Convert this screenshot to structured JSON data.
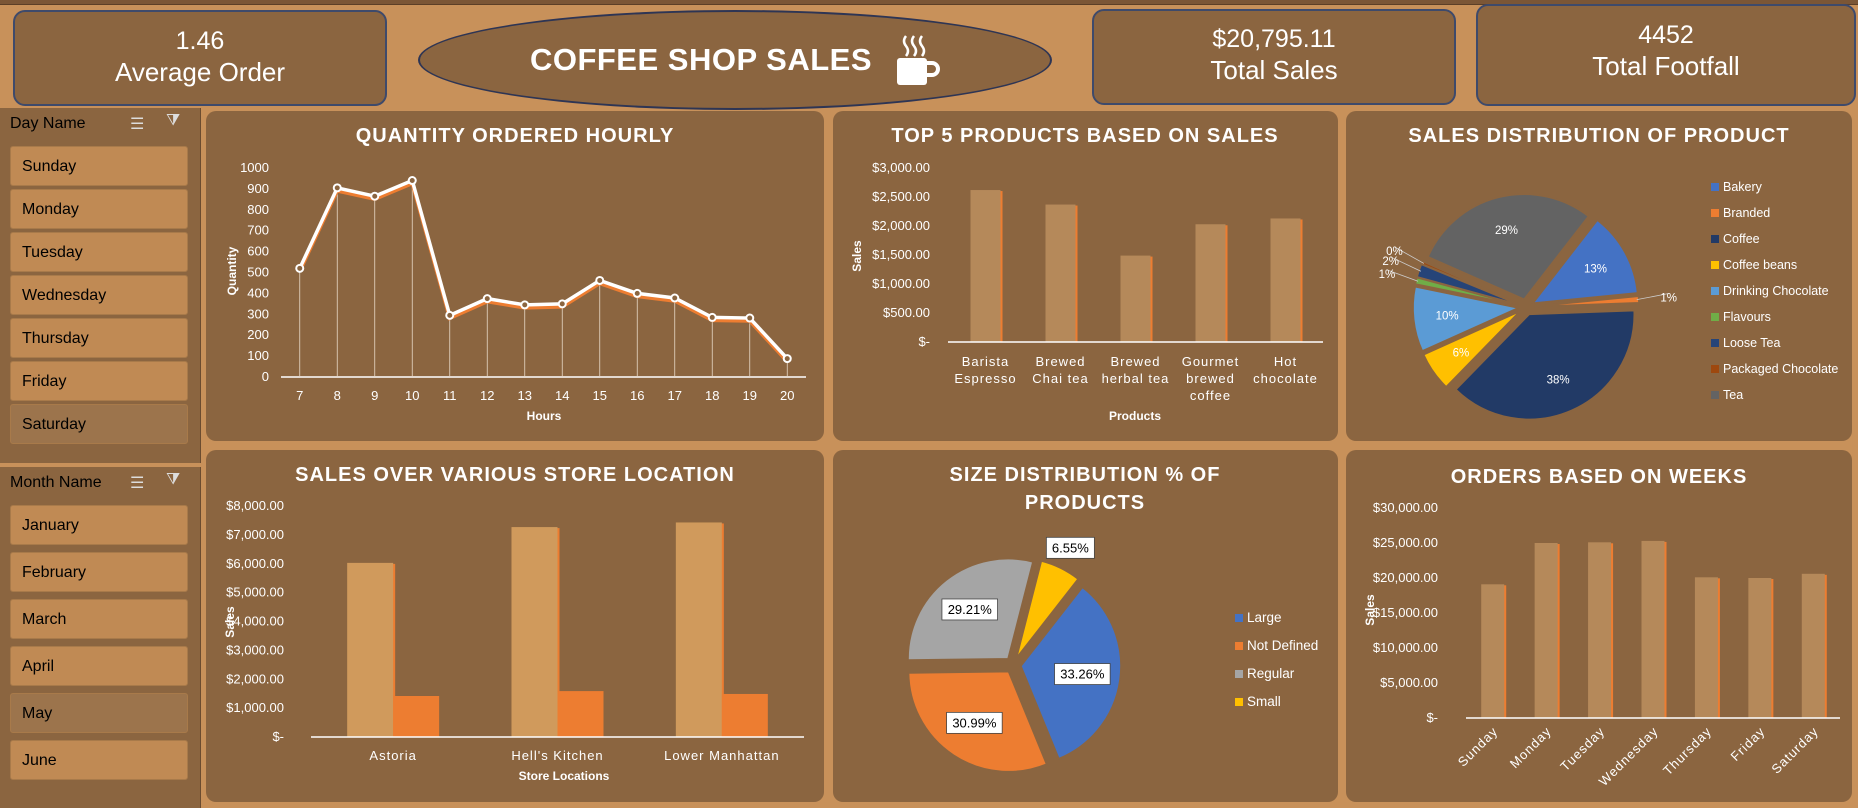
{
  "header": {
    "avg_order_value": "1.46",
    "avg_order_label": "Average Order",
    "title": "COFFEE SHOP SALES",
    "total_sales_value": "$20,795.11",
    "total_sales_label": "Total Sales",
    "footfall_value": "4452",
    "footfall_label": "Total Footfall"
  },
  "slicers": {
    "day": {
      "title": "Day Name",
      "items": [
        "Sunday",
        "Monday",
        "Tuesday",
        "Wednesday",
        "Thursday",
        "Friday",
        "Saturday"
      ]
    },
    "month": {
      "title": "Month Name",
      "items": [
        "January",
        "February",
        "March",
        "April",
        "May",
        "June"
      ]
    }
  },
  "colors": {
    "background": "#c8915a",
    "panel": "#8b6540",
    "bar_primary": "#b5895a",
    "bar_orange": "#ed7d31",
    "bar_light": "#d09a5c"
  },
  "chart_data": [
    {
      "type": "line",
      "title": "QUANTITY ORDERED HOURLY",
      "xlabel": "Hours",
      "ylabel": "Quantity",
      "x": [
        "7",
        "8",
        "9",
        "10",
        "11",
        "12",
        "13",
        "14",
        "15",
        "16",
        "17",
        "18",
        "19",
        "20"
      ],
      "series": [
        {
          "values": [
            520,
            905,
            865,
            940,
            295,
            375,
            345,
            350,
            462,
            400,
            378,
            285,
            282,
            88
          ]
        }
      ],
      "ylim": [
        0,
        1000
      ],
      "yticks": [
        "0",
        "100",
        "200",
        "300",
        "400",
        "500",
        "600",
        "700",
        "800",
        "900",
        "1000"
      ]
    },
    {
      "type": "bar",
      "title": "TOP 5 PRODUCTS BASED ON SALES",
      "xlabel": "Products",
      "ylabel": "Sales",
      "categories": [
        [
          "Barista",
          "Espresso"
        ],
        [
          "Brewed",
          "Chai tea"
        ],
        [
          "Brewed",
          "herbal tea"
        ],
        [
          "Gourmet",
          "brewed",
          "coffee"
        ],
        [
          "Hot",
          "chocolate"
        ]
      ],
      "values": [
        2620,
        2370,
        1490,
        2030,
        2130
      ],
      "ylim": [
        0,
        3000
      ],
      "yticks": [
        "$-",
        "$500.00",
        "$1,000.00",
        "$1,500.00",
        "$2,000.00",
        "$2,500.00",
        "$3,000.00"
      ]
    },
    {
      "type": "pie",
      "title": "SALES DISTRIBUTION OF PRODUCT",
      "slices": [
        {
          "name": "Bakery",
          "value": 13,
          "label": "13%",
          "color": "#4472c4"
        },
        {
          "name": "Branded",
          "value": 1,
          "label": "1%",
          "color": "#ed7d31"
        },
        {
          "name": "Coffee",
          "value": 38,
          "label": "38%",
          "color": "#223a66"
        },
        {
          "name": "Coffee beans",
          "value": 6,
          "label": "6%",
          "color": "#ffc000"
        },
        {
          "name": "Drinking Chocolate",
          "value": 10,
          "label": "10%",
          "color": "#5b9bd5"
        },
        {
          "name": "Flavours",
          "value": 1,
          "label": "1%",
          "color": "#70ad47"
        },
        {
          "name": "Loose Tea",
          "value": 2,
          "label": "2%",
          "color": "#264478"
        },
        {
          "name": "Packaged Chocolate",
          "value": 0.4,
          "label": "0%",
          "color": "#9e480e"
        },
        {
          "name": "Tea",
          "value": 29,
          "label": "29%",
          "color": "#636363"
        }
      ],
      "legend": "right"
    },
    {
      "type": "bar",
      "title": "SALES OVER VARIOUS STORE LOCATION",
      "xlabel": "Store Locations",
      "ylabel": "Sales",
      "categories": [
        "Astoria",
        "Hell's Kitchen",
        "Lower Manhattan"
      ],
      "series": [
        {
          "values": [
            6030,
            7270,
            7430
          ]
        },
        {
          "values": [
            1420,
            1590,
            1490
          ]
        }
      ],
      "ylim": [
        0,
        8000
      ],
      "yticks": [
        "$-",
        "$1,000.00",
        "$2,000.00",
        "$3,000.00",
        "$4,000.00",
        "$5,000.00",
        "$6,000.00",
        "$7,000.00",
        "$8,000.00"
      ]
    },
    {
      "type": "pie",
      "title_lines": [
        "SIZE DISTRIBUTION % OF",
        "PRODUCTS"
      ],
      "slices": [
        {
          "name": "Large",
          "value": 33.26,
          "label": "33.26%",
          "color": "#4472c4"
        },
        {
          "name": "Not Defined",
          "value": 30.99,
          "label": "30.99%",
          "color": "#ed7d31"
        },
        {
          "name": "Regular",
          "value": 29.21,
          "label": "29.21%",
          "color": "#a5a5a5"
        },
        {
          "name": "Small",
          "value": 6.55,
          "label": "6.55%",
          "color": "#ffc000"
        }
      ],
      "legend": "right"
    },
    {
      "type": "bar",
      "title": "ORDERS BASED ON WEEKS",
      "ylabel": "Sales",
      "categories": [
        "Sunday",
        "Monday",
        "Tuesday",
        "Wednesday",
        "Thursday",
        "Friday",
        "Saturday"
      ],
      "values": [
        19100,
        25000,
        25100,
        25300,
        20100,
        20000,
        20600
      ],
      "ylim": [
        0,
        30000
      ],
      "yticks": [
        "$-",
        "$5,000.00",
        "$10,000.00",
        "$15,000.00",
        "$20,000.00",
        "$25,000.00",
        "$30,000.00"
      ]
    }
  ]
}
